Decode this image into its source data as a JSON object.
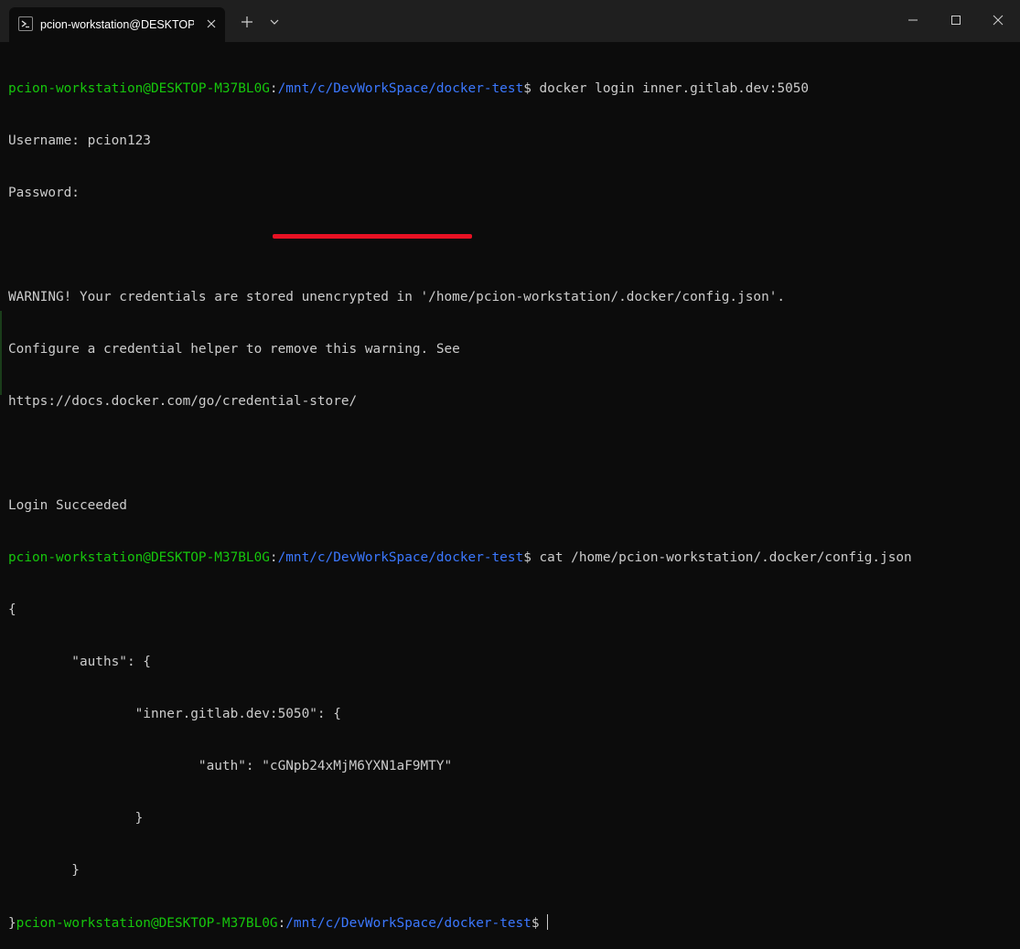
{
  "window": {
    "tab_title": "pcion-workstation@DESKTOP-",
    "new_tab_label": "+",
    "colors": {
      "titlebar": "#1f1f1f",
      "terminal_bg": "#0c0c0c",
      "prompt_user": "#16c60c",
      "prompt_path": "#3b78ff",
      "text": "#cccccc",
      "redaction": "#e81123"
    }
  },
  "prompt": {
    "user_host": "pcion-workstation@DESKTOP-M37BL0G",
    "sep": ":",
    "path": "/mnt/c/DevWorkSpace/docker-test",
    "dollar": "$"
  },
  "terminal": {
    "cmd1": " docker login inner.gitlab.dev:5050",
    "username": "Username: pcion123",
    "password": "Password:",
    "warning1": "WARNING! Your credentials are stored unencrypted in '/home/pcion-workstation/.docker/config.json'.",
    "warning2": "Configure a credential helper to remove this warning. See",
    "warning3": "https://docs.docker.com/go/credential-store/",
    "login_ok": "Login Succeeded",
    "cmd2": " cat /home/pcion-workstation/.docker/config.json",
    "json_open": "{",
    "auths_line": "        \"auths\": {",
    "host_line": "                \"inner.gitlab.dev:5050\": {",
    "auth_line": "                        \"auth\": \"cGNpb24xMjM6YXN1aF9MTY\"",
    "inner_close": "                }",
    "auths_close": "        }",
    "json_close": "}",
    "last_cmd_suffix": " "
  }
}
